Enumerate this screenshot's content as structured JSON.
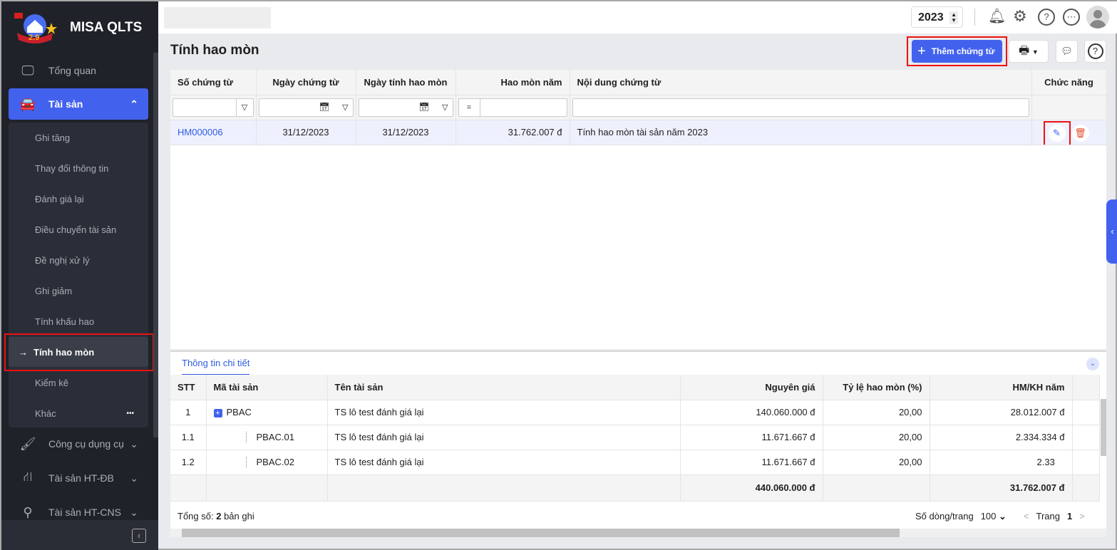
{
  "app": {
    "name": "MISA QLTS",
    "logo_text": "2.9"
  },
  "sidebar": {
    "items": [
      {
        "label": "Tổng quan",
        "icon": "monitor-chart-icon"
      },
      {
        "label": "Tài sản",
        "icon": "house-car-icon"
      },
      {
        "label": "Công cụ dụng cụ",
        "icon": "paint-roller-icon"
      },
      {
        "label": "Tài sản HT-ĐB",
        "icon": "road-icon"
      },
      {
        "label": "Tài sản HT-CNS",
        "icon": "pipe-icon"
      }
    ],
    "sub_items": [
      "Ghi tăng",
      "Thay đổi thông tin",
      "Đánh giá lại",
      "Điều chuyển tài sản",
      "Đề nghị xử lý",
      "Ghi giảm",
      "Tính khấu hao",
      "Tính hao mòn",
      "Kiểm kê",
      "Khác"
    ],
    "more": "•••"
  },
  "topbar": {
    "year": "2023"
  },
  "page": {
    "title": "Tính hao mòn",
    "add_button": "Thêm chứng từ"
  },
  "grid": {
    "columns": [
      "Số chứng từ",
      "Ngày chứng từ",
      "Ngày tính hao mòn",
      "Hao mòn năm",
      "Nội dung chứng từ",
      "Chức năng"
    ],
    "filter_op": "=",
    "rows": [
      {
        "so": "HM000006",
        "ngay": "31/12/2023",
        "ngay_hm": "31/12/2023",
        "hao_mon": "31.762.007 đ",
        "noi_dung": "Tính hao mòn tài sản năm 2023"
      }
    ]
  },
  "detail": {
    "tab": "Thông tin chi tiết",
    "columns": [
      "STT",
      "Mã tài sản",
      "Tên tài sản",
      "Nguyên giá",
      "Tỷ lệ hao mòn (%)",
      "HM/KH năm"
    ],
    "rows": [
      {
        "stt": "1",
        "ma": "PBAC",
        "ten": "TS lô test đánh giá lại",
        "ng": "140.060.000 đ",
        "tl": "20,00",
        "hm": "28.012.007 đ"
      },
      {
        "stt": "1.1",
        "ma": "PBAC.01",
        "ten": "TS lô test đánh giá lại",
        "ng": "11.671.667 đ",
        "tl": "20,00",
        "hm": "2.334.334 đ"
      },
      {
        "stt": "1.2",
        "ma": "PBAC.02",
        "ten": "TS lô test đánh giá lại",
        "ng": "11.671.667 đ",
        "tl": "20,00",
        "hm": "2.33"
      }
    ],
    "totals": {
      "ng": "440.060.000 đ",
      "hm": "31.762.007 đ"
    },
    "footer": {
      "total_label": "Tổng số:",
      "total_count": "2",
      "total_suffix": "bản ghi",
      "page_size_label": "Số dòng/trang",
      "page_size": "100",
      "prev": "<",
      "page_label": "Trang",
      "page": "1",
      "next": ">"
    }
  }
}
